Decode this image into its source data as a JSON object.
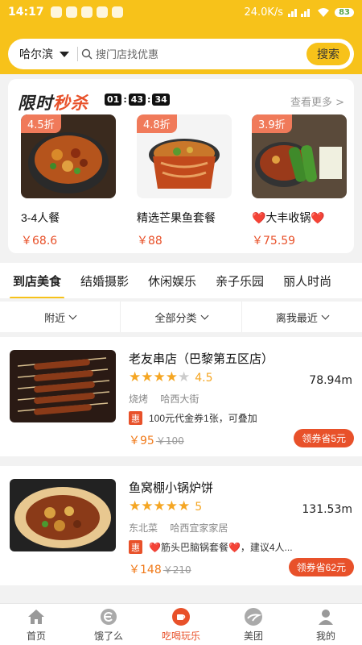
{
  "status_bar": {
    "time": "14:17",
    "speed": "24.0K/s",
    "battery": "83"
  },
  "header": {
    "city": "哈尔滨",
    "search_placeholder": "搜门店找优惠",
    "search_button": "搜索"
  },
  "flash_sale": {
    "title_prefix": "限时",
    "title_highlight": "秒杀",
    "timer": [
      "01",
      "43",
      "34"
    ],
    "more": "查看更多 >",
    "items": [
      {
        "discount": "4.5折",
        "name": "3-4人餐",
        "price": "￥68.6"
      },
      {
        "discount": "4.8折",
        "name": "精选芒果鱼套餐",
        "price": "￥88"
      },
      {
        "discount": "3.9折",
        "name": "❤️大丰收锅❤️",
        "price": "￥75.59"
      }
    ]
  },
  "tabs": [
    "到店美食",
    "结婚摄影",
    "休闲娱乐",
    "亲子乐园",
    "丽人时尚"
  ],
  "filters": [
    "附近",
    "全部分类",
    "离我最近"
  ],
  "shops": [
    {
      "name": "老友串店（巴黎第五区店）",
      "rating": "4.5",
      "stars": 4.5,
      "distance": "78.94m",
      "category": "烧烤",
      "area": "哈西大街",
      "promo_tag": "惠",
      "promo": "100元代金券1张，可叠加",
      "price_now": "￥95",
      "price_old": "￥100",
      "coupon": "领券省5元"
    },
    {
      "name": "鱼窝棚小锅炉饼",
      "rating": "5",
      "stars": 5,
      "distance": "131.53m",
      "category": "东北菜",
      "area": "哈西宜家家居",
      "promo_tag": "惠",
      "promo": "❤️筋头巴脑锅套餐❤️，建议4人...",
      "price_now": "￥148",
      "price_old": "￥210",
      "coupon": "领券省62元"
    }
  ],
  "bottom_nav": [
    "首页",
    "饿了么",
    "吃喝玩乐",
    "美团",
    "我的"
  ],
  "colors": {
    "brand_yellow": "#f7c21a",
    "accent_red": "#e8512a",
    "star": "#f5a623"
  }
}
